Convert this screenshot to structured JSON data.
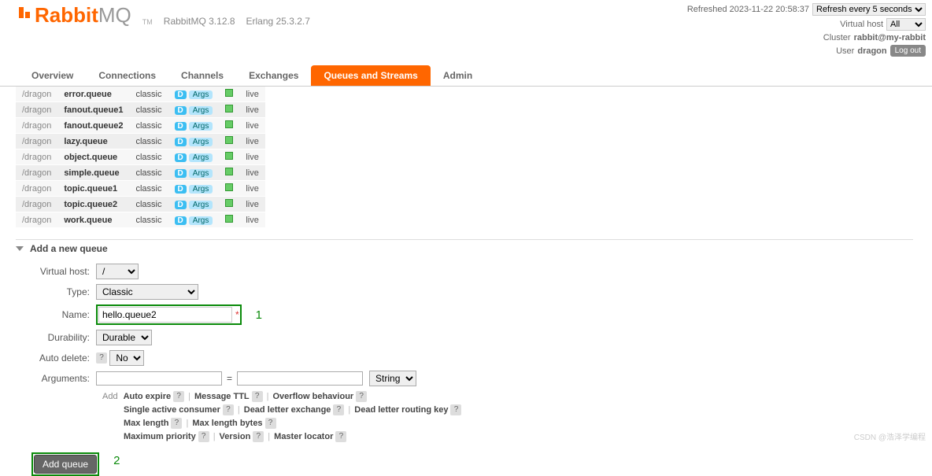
{
  "header": {
    "logo_text": "Rabbit",
    "logo_suffix": "MQ",
    "tm": "TM",
    "version": "RabbitMQ 3.12.8",
    "erlang": "Erlang 25.3.2.7"
  },
  "meta": {
    "refreshed": "Refreshed 2023-11-22 20:58:37",
    "refresh_select": "Refresh every 5 seconds",
    "vhost_label": "Virtual host",
    "vhost_value": "All",
    "cluster_label": "Cluster",
    "cluster_value": "rabbit@my-rabbit",
    "user_label": "User",
    "user_value": "dragon",
    "logout": "Log out"
  },
  "nav": [
    "Overview",
    "Connections",
    "Channels",
    "Exchanges",
    "Queues and Streams",
    "Admin"
  ],
  "nav_active": 4,
  "queues": [
    {
      "vhost": "/dragon",
      "name": "error.queue",
      "type": "classic",
      "d": "D",
      "args": "Args",
      "state": "live"
    },
    {
      "vhost": "/dragon",
      "name": "fanout.queue1",
      "type": "classic",
      "d": "D",
      "args": "Args",
      "state": "live"
    },
    {
      "vhost": "/dragon",
      "name": "fanout.queue2",
      "type": "classic",
      "d": "D",
      "args": "Args",
      "state": "live"
    },
    {
      "vhost": "/dragon",
      "name": "lazy.queue",
      "type": "classic",
      "d": "D",
      "args": "Args",
      "state": "live"
    },
    {
      "vhost": "/dragon",
      "name": "object.queue",
      "type": "classic",
      "d": "D",
      "args": "Args",
      "state": "live"
    },
    {
      "vhost": "/dragon",
      "name": "simple.queue",
      "type": "classic",
      "d": "D",
      "args": "Args",
      "state": "live"
    },
    {
      "vhost": "/dragon",
      "name": "topic.queue1",
      "type": "classic",
      "d": "D",
      "args": "Args",
      "state": "live"
    },
    {
      "vhost": "/dragon",
      "name": "topic.queue2",
      "type": "classic",
      "d": "D",
      "args": "Args",
      "state": "live"
    },
    {
      "vhost": "/dragon",
      "name": "work.queue",
      "type": "classic",
      "d": "D",
      "args": "Args",
      "state": "live"
    }
  ],
  "section": {
    "title": "Add a new queue"
  },
  "form": {
    "vhost_label": "Virtual host:",
    "vhost_value": "/",
    "type_label": "Type:",
    "type_value": "Classic",
    "name_label": "Name:",
    "name_value": "hello.queue2",
    "annot1": "1",
    "durability_label": "Durability:",
    "durability_value": "Durable",
    "autodel_label": "Auto delete:",
    "autodel_value": "No",
    "args_label": "Arguments:",
    "args_eq": "=",
    "args_type": "String",
    "add_label": "Add",
    "arg_groups": [
      [
        "Auto expire",
        "Message TTL",
        "Overflow behaviour"
      ],
      [
        "Single active consumer",
        "Dead letter exchange",
        "Dead letter routing key"
      ],
      [
        "Max length",
        "Max length bytes"
      ],
      [
        "Maximum priority",
        "Version",
        "Master locator"
      ]
    ],
    "submit": "Add queue",
    "annot2": "2"
  },
  "watermark": "CSDN @浩泽学编程"
}
